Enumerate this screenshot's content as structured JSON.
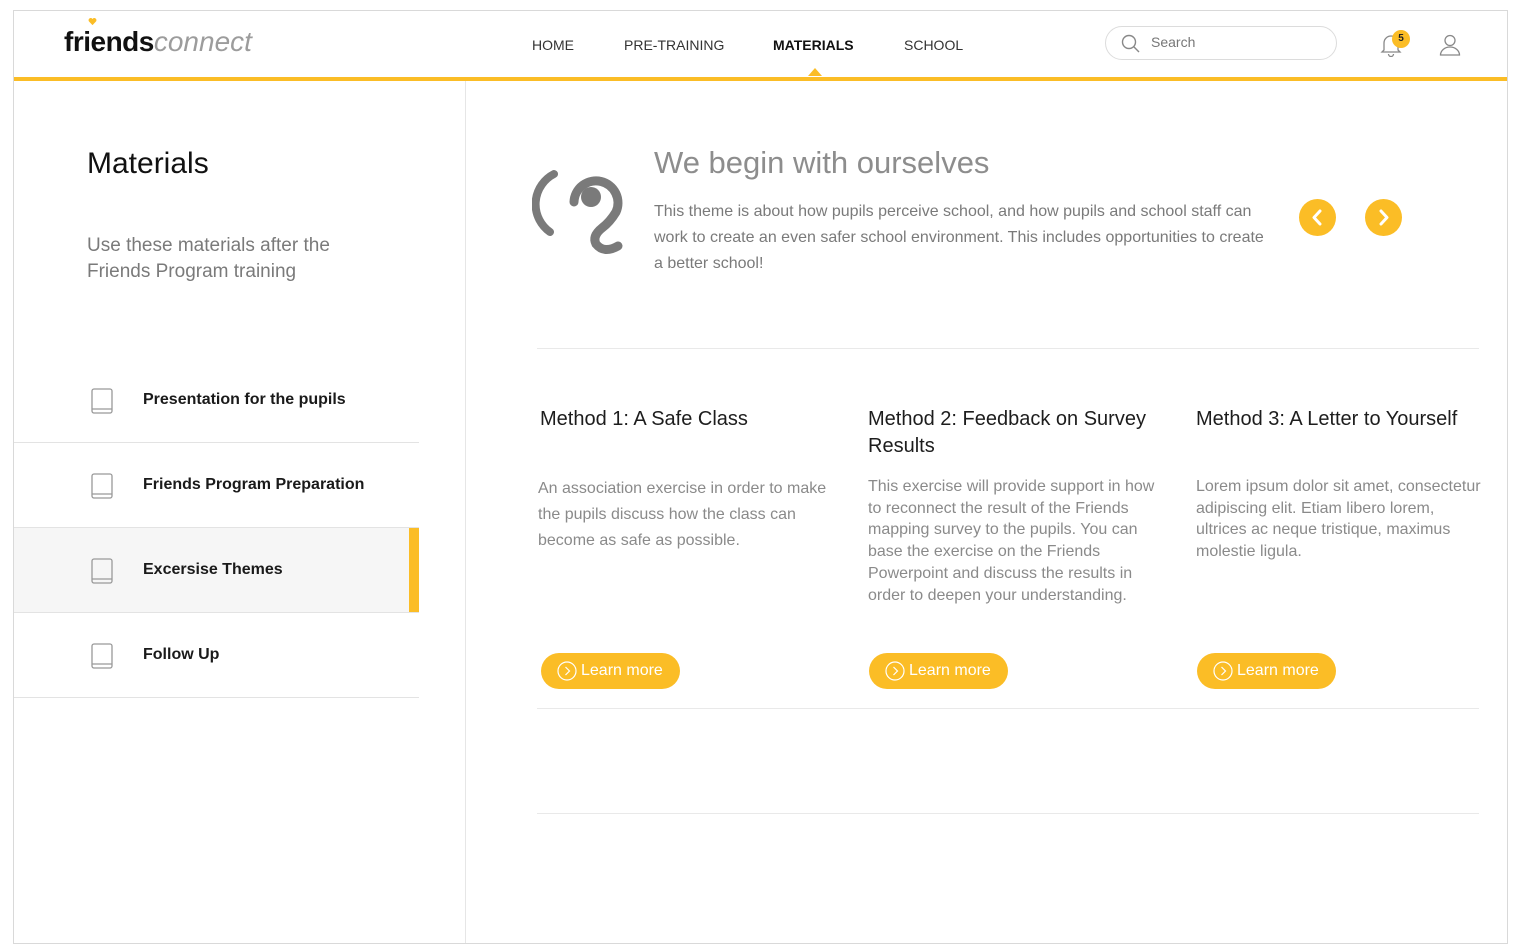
{
  "brand": {
    "bold": "friends",
    "light": "connect",
    "accent": "#fbbd26"
  },
  "nav": {
    "items": [
      "HOME",
      "PRE-TRAINING",
      "MATERIALS",
      "SCHOOL"
    ],
    "active": "MATERIALS"
  },
  "search": {
    "placeholder": "Search"
  },
  "notifications": {
    "count": "5"
  },
  "sidebar": {
    "title": "Materials",
    "subtitle": "Use these materials after the Friends Program training",
    "items": [
      {
        "label": "Presentation for the pupils",
        "icon": "book-icon"
      },
      {
        "label": "Friends Program Preparation",
        "icon": "book-icon"
      },
      {
        "label": "Excersise Themes",
        "icon": "book-icon",
        "active": true
      },
      {
        "label": "Follow Up",
        "icon": "book-icon"
      }
    ]
  },
  "hero": {
    "icon": "ear-icon",
    "title": "We begin with ourselves",
    "description": "This theme is about how pupils perceive school, and how pupils and school staff can work to create an even safer school environment. This includes opportunities to create a better school!"
  },
  "cards": [
    {
      "title": "Method 1: A Safe Class",
      "text": "An association exercise in order to make the pupils discuss how the class can become as safe as possible.",
      "button": "Learn more"
    },
    {
      "title": "Method 2: Feedback on Survey Results",
      "text": "This exercise will provide support in how to reconnect the result of the Friends mapping survey to the pupils. You can base the exercise on the Friends Powerpoint and discuss the results in order to deepen your understanding.",
      "button": "Learn more"
    },
    {
      "title": "Method 3: A Letter to Yourself",
      "text": "Lorem ipsum dolor sit amet, consectetur adipiscing elit. Etiam libero lorem, ultrices ac neque tristique, maximus molestie ligula.",
      "button": "Learn more"
    }
  ]
}
